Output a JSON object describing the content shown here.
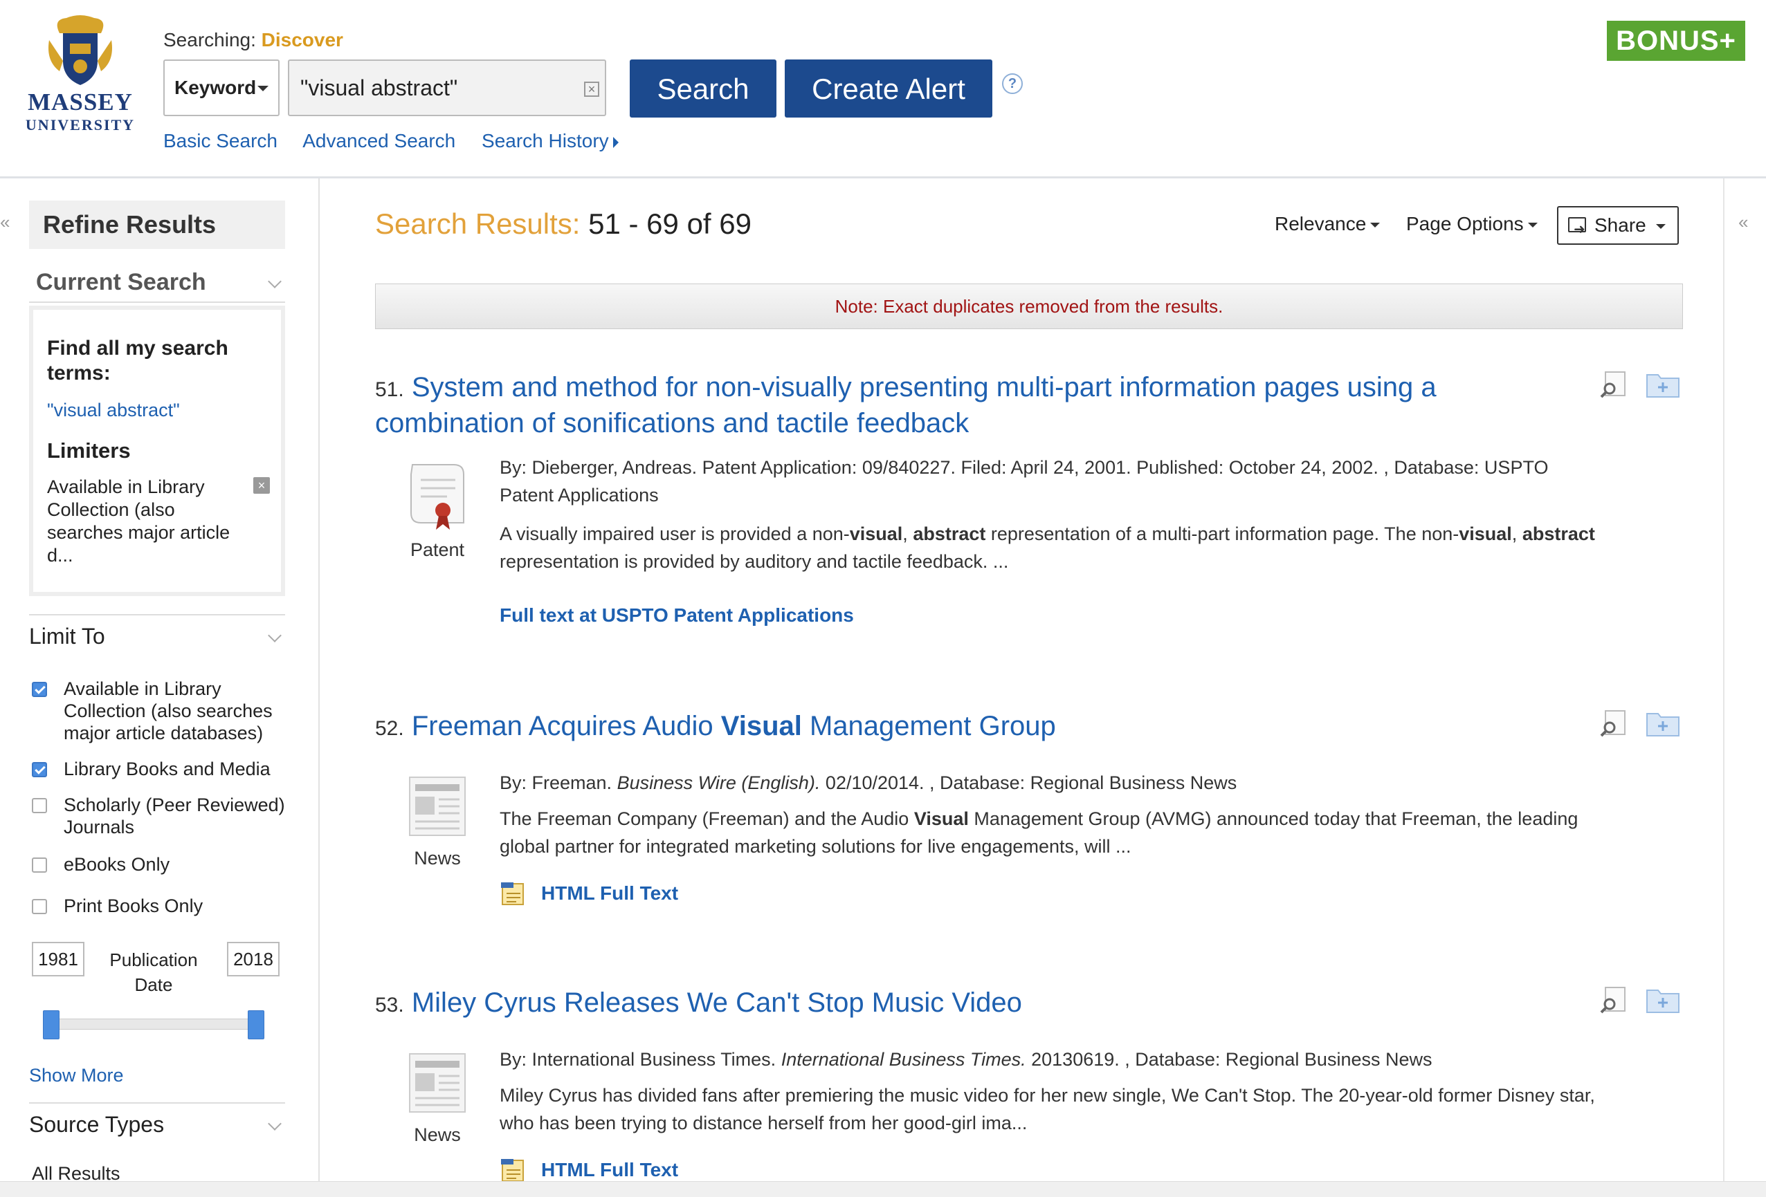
{
  "header": {
    "logo": {
      "line1": "MASSEY",
      "line2": "UNIVERSITY"
    },
    "searching_label": "Searching:",
    "searching_db": "Discover",
    "field_select": "Keyword",
    "search_value": "\"visual abstract\"",
    "search_button": "Search",
    "create_alert_button": "Create Alert",
    "help": "?",
    "links": {
      "basic": "Basic Search",
      "advanced": "Advanced Search",
      "history": "Search History"
    },
    "bonus": "BONUS+"
  },
  "sidebar": {
    "collapse": "«",
    "refine_title": "Refine Results",
    "current_search": "Current Search",
    "find_all_label": "Find all my search terms:",
    "search_term": "\"visual abstract\"",
    "limiters_label": "Limiters",
    "limiter_text": "Available in Library Collection (also searches major article d...",
    "limiter_remove": "×",
    "limit_to": "Limit To",
    "checkboxes": [
      {
        "label": "Available in Library Collection (also searches major article databases)",
        "checked": true
      },
      {
        "label": "Library Books and Media",
        "checked": true
      },
      {
        "label": "Scholarly (Peer Reviewed) Journals",
        "checked": false
      },
      {
        "label": "eBooks Only",
        "checked": false
      },
      {
        "label": "Print Books Only",
        "checked": false
      }
    ],
    "year_from": "1981",
    "year_to": "2018",
    "pub_date_label": "Publication Date",
    "show_more": "Show More",
    "source_types": "Source Types",
    "all_results": "All Results"
  },
  "main": {
    "results_label": "Search Results:",
    "results_range": "51 - 69 of 69",
    "relevance": "Relevance",
    "page_options": "Page Options",
    "share": "Share",
    "note": "Note: Exact duplicates removed from the results.",
    "results": [
      {
        "num": "51.",
        "title": "System and method for non-visually presenting multi-part information pages using a combination of sonifications and tactile feedback",
        "type": "Patent",
        "meta": "By: Dieberger, Andreas. Patent Application: 09/840227. Filed: April 24, 2001. Published: October 24, 2002. , Database: USPTO Patent Applications",
        "abstract_parts": [
          "A visually impaired user is provided a non-",
          "visual",
          ", ",
          "abstract",
          " representation of a multi-part information page. The non-",
          "visual",
          ", ",
          "abstract",
          " representation is provided by auditory and tactile feedback. ..."
        ],
        "link": "Full text at USPTO Patent Applications"
      },
      {
        "num": "52.",
        "title_parts": [
          "Freeman Acquires Audio ",
          "Visual",
          " Management Group"
        ],
        "type": "News",
        "meta_parts": [
          "By: Freeman. ",
          "Business Wire (English).",
          " 02/10/2014. , Database: Regional Business News"
        ],
        "abstract_parts": [
          "The Freeman Company (Freeman) and the Audio ",
          "Visual",
          " Management Group (AVMG) announced today that Freeman, the leading global partner for integrated marketing solutions for live engagements, will ..."
        ],
        "link": "HTML Full Text"
      },
      {
        "num": "53.",
        "title": "Miley Cyrus Releases We Can't Stop Music Video",
        "type": "News",
        "meta_parts": [
          "By: International Business Times. ",
          "International Business Times.",
          " 20130619. , Database: Regional Business News"
        ],
        "abstract": "Miley Cyrus has divided fans after premiering the music video for her new single, We Can't Stop. The 20-year-old former Disney star, who has been trying to distance herself from her good-girl ima...",
        "link": "HTML Full Text"
      }
    ]
  },
  "colors": {
    "accent_blue": "#1c4a8e",
    "link_blue": "#1e60b0",
    "orange": "#e2a13a",
    "bonus_green": "#5aa532",
    "note_red": "#a11313"
  },
  "icons": [
    "clear-icon",
    "help-icon",
    "share-icon",
    "patent-icon",
    "news-icon",
    "html-fulltext-icon",
    "preview-icon",
    "add-folder-icon"
  ]
}
